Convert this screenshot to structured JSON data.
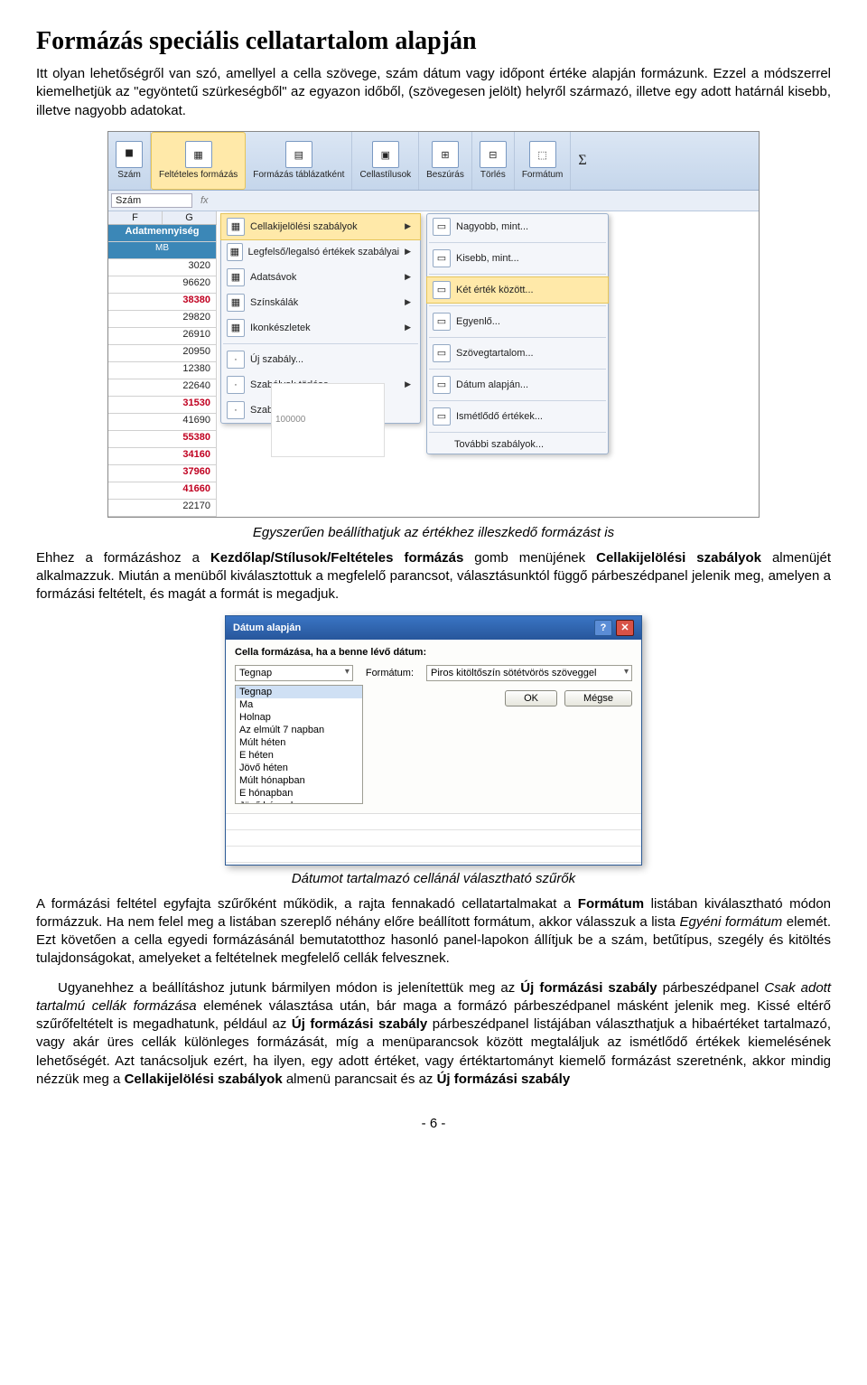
{
  "title": "Formázás speciális cellatartalom alapján",
  "para1": "Itt olyan lehetőségről van szó, amellyel a cella szövege, szám dátum vagy időpont értéke alapján formázunk. Ezzel a módszerrel kiemelhetjük az \"egyöntetű szürkeségből\" az egyazon időből, (szövegesen jelölt) helyről származó, illetve egy adott határnál kisebb, illetve nagyobb adatokat.",
  "ribbon": {
    "namebox_label": "Szám",
    "namebox_value": "Szám",
    "groups": [
      "Feltételes formázás",
      "Formázás táblázatként",
      "Cellastílusok",
      "Beszúrás",
      "Törlés",
      "Formátum"
    ]
  },
  "sheet": {
    "col_f": "F",
    "col_g": "G",
    "header1": "Adatmennyiség",
    "header2": "MB",
    "values": [
      "3020",
      "96620",
      "38380",
      "29820",
      "26910",
      "20950",
      "12380",
      "22640",
      "31530",
      "41690",
      "55380",
      "34160",
      "37960",
      "41660",
      "22170"
    ],
    "red_rows": [
      2,
      8,
      10,
      11,
      12,
      13
    ],
    "chart_label": "100000"
  },
  "menu1": {
    "items": [
      {
        "icon": "rules",
        "label": "Cellakijelölési szabályok",
        "chev": true,
        "sel": true
      },
      {
        "icon": "top",
        "label": "Legfelső/legalsó értékek szabályai",
        "chev": true
      },
      {
        "icon": "databars",
        "label": "Adatsávok",
        "chev": true
      },
      {
        "icon": "colorscale",
        "label": "Színskálák",
        "chev": true
      },
      {
        "icon": "iconset",
        "label": "Ikonkészletek",
        "chev": true
      }
    ],
    "footer": [
      {
        "label": "Új szabály..."
      },
      {
        "label": "Szabályok törlése",
        "chev": true
      },
      {
        "label": "Szabályok kezelése..."
      }
    ]
  },
  "menu2": {
    "items": [
      {
        "icon": "gt",
        "label": "Nagyobb, mint..."
      },
      {
        "icon": "lt",
        "label": "Kisebb, mint..."
      },
      {
        "icon": "between",
        "label": "Két érték között...",
        "sel": true
      },
      {
        "icon": "eq",
        "label": "Egyenlő..."
      },
      {
        "icon": "text",
        "label": "Szövegtartalom..."
      },
      {
        "icon": "date",
        "label": "Dátum alapján..."
      },
      {
        "icon": "dup",
        "label": "Ismétlődő értékek..."
      }
    ],
    "footer_label": "További szabályok..."
  },
  "caption1": "Egyszerűen beállíthatjuk az értékhez illeszkedő formázást is",
  "para2_a": "Ehhez a formázáshoz a ",
  "para2_b": "Kezdőlap/Stílusok/Feltételes formázás",
  "para2_c": " gomb menüjének ",
  "para2_d": "Cellakijelölési szabályok",
  "para2_e": " almenüjét alkalmazzuk. Miután a menüből kiválasztottuk a megfelelő parancsot, választásunktól függő párbeszédpanel jelenik meg, amelyen a formázási feltételt, és magát a formát is megadjuk.",
  "dialog": {
    "title": "Dátum alapján",
    "header": "Cella formázása, ha a benne lévő dátum:",
    "combo1": "Tegnap",
    "format_label": "Formátum:",
    "combo2": "Piros kitöltőszín sötétvörös szöveggel",
    "list": [
      "Tegnap",
      "Ma",
      "Holnap",
      "Az elmúlt 7 napban",
      "Múlt héten",
      "E héten",
      "Jövő héten",
      "Múlt hónapban",
      "E hónapban",
      "Jövő hónapban"
    ],
    "ok": "OK",
    "cancel": "Mégse"
  },
  "caption2": "Dátumot tartalmazó cellánál választható szűrők",
  "para3_a": "A formázási feltétel egyfajta szűrőként működik, a rajta fennakadó cellatartalmakat a ",
  "para3_b": "Formátum",
  "para3_c": " listában kiválasztható módon formázzuk. Ha nem felel meg a listában szereplő néhány előre beállított formátum, akkor válasszuk a lista ",
  "para3_d": "Egyéni formátum",
  "para3_e": " elemét. Ezt követően a cella egyedi formázásánál bemutatotthoz hasonló panel-lapokon állítjuk be a szám, betűtípus, szegély és kitöltés tulajdonságokat, amelyeket a feltételnek megfelelő cellák felvesznek.",
  "para4_a": "Ugyanehhez a beállításhoz jutunk bármilyen módon is jelenítettük meg az ",
  "para4_b": "Új formázási szabály",
  "para4_c": " párbeszédpanel ",
  "para4_d": "Csak adott tartalmú cellák formázása",
  "para4_e": " elemének választása után, bár maga a formázó párbeszédpanel másként jelenik meg. Kissé eltérő szűrőfeltételt is megadhatunk, például az ",
  "para4_f": "Új formázási szabály",
  "para4_g": " párbeszédpanel listájában választhatjuk a hibaértéket tartalmazó, vagy akár üres cellák különleges formázását, míg a menüparancsok között megtaláljuk az ismétlődő értékek kiemelésének lehetőségét. Azt tanácsoljuk ezért, ha ilyen, egy adott értéket, vagy értéktartományt kiemelő formázást szeretnénk, akkor mindig nézzük meg a ",
  "para4_h": "Cellakijelölési szabályok",
  "para4_i": " almenü parancsait és az ",
  "para4_j": "Új formázási szabály",
  "page_num": "- 6 -"
}
